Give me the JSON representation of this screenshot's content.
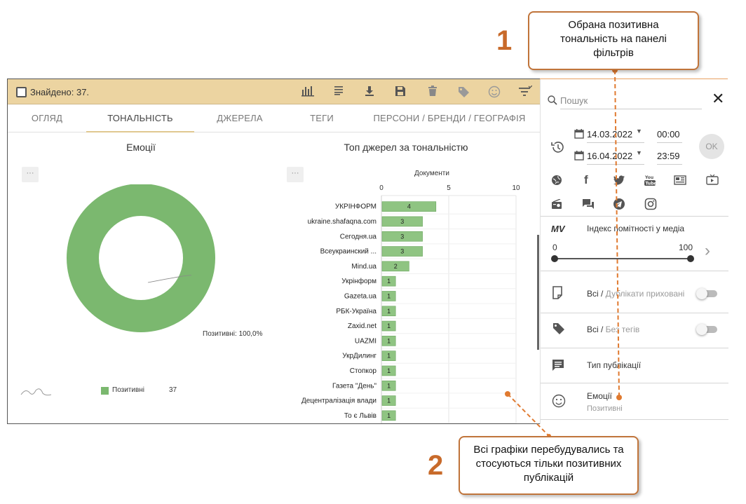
{
  "topbar": {
    "found_label": "Знайдено: 37."
  },
  "tabs": [
    {
      "label": "ОГЛЯД"
    },
    {
      "label": "ТОНАЛЬНІСТЬ"
    },
    {
      "label": "ДЖЕРЕЛА"
    },
    {
      "label": "ТЕГИ"
    },
    {
      "label": "ПЕРСОНИ / БРЕНДИ / ГЕОГРАФІЯ"
    }
  ],
  "emotions_chart": {
    "title": "Емоції",
    "menu": "···",
    "slice_label": "Позитивні: 100,0%",
    "legend_label": "Позитивні",
    "legend_value": "37"
  },
  "sources_chart": {
    "title": "Топ джерел за тональністю",
    "menu": "···",
    "axis_title": "Документи",
    "ticks": [
      "0",
      "5",
      "10"
    ]
  },
  "chart_data": [
    {
      "type": "pie",
      "title": "Емоції",
      "labels": [
        "Позитивні"
      ],
      "values": [
        37
      ],
      "percent": [
        100.0
      ]
    },
    {
      "type": "bar",
      "title": "Топ джерел за тональністю",
      "xlabel": "Документи",
      "xlim": [
        0,
        10
      ],
      "categories": [
        "УКРІНФОРМ",
        "ukraine.shafaqna.com",
        "Сегодня.ua",
        "Всеукраинский ...",
        "Mind.ua",
        "Укрінформ",
        "Gazeta.ua",
        "РБК-Україна",
        "Zaxid.net",
        "UAZMI",
        "УкрДилинг",
        "Стопкор",
        "Газета \"День\"",
        "Децентралізація влади",
        "То є Львів"
      ],
      "values": [
        4,
        3,
        3,
        3,
        2,
        1,
        1,
        1,
        1,
        1,
        1,
        1,
        1,
        1,
        1
      ]
    }
  ],
  "filters": {
    "search_placeholder": "Пошук",
    "date_from": "14.03.2022",
    "date_to": "16.04.2022",
    "time_from": "00:00",
    "time_to": "23:59",
    "ok_label": "OK",
    "mv_label": "MV",
    "media_index_label": "Індекс помітності у медіа",
    "range_min": "0",
    "range_max": "100",
    "duplicates_all": "Всі /",
    "duplicates_hidden": " Дублікати приховані",
    "tags_all": "Всі /",
    "tags_none": " Без тегів",
    "pub_type_label": "Тип публікації",
    "emotions_label": "Емоції",
    "emotions_value": "Позитивні"
  },
  "callouts": {
    "num1": "1",
    "text1": "Обрана позитивна тональність на панелі фільтрів",
    "num2": "2",
    "text2": "Всі графіки перебудувались та стосуються тільки позитивних публікацій"
  },
  "colors": {
    "accent": "#ecd4a1",
    "positive": "#7bb86f",
    "callout_border": "#c0743a",
    "callout_number": "#c86a2a"
  }
}
